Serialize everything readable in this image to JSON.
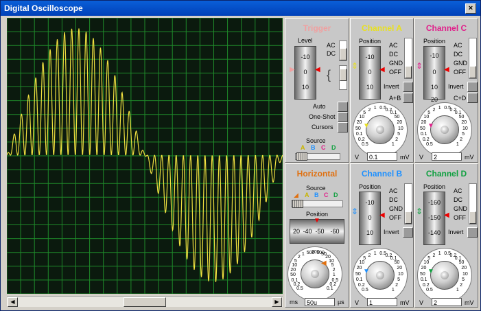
{
  "window": {
    "title": "Digital Oscilloscope",
    "close": "×"
  },
  "colors": {
    "trace": "#f0e040",
    "grid": "#1f8a2a",
    "screen": "#0b1a0e",
    "trigger": "#f0a0a0",
    "channel_a": "#e8e020",
    "channel_b": "#1e90ff",
    "channel_c": "#e0208a",
    "channel_d": "#10a040",
    "horizontal": "#e07010"
  },
  "trigger": {
    "title": "Trigger",
    "level_label": "Level",
    "level_ticks": [
      "-10",
      "0",
      "10"
    ],
    "ac": "AC",
    "dc": "DC",
    "auto": "Auto",
    "one_shot": "One-Shot",
    "cursors": "Cursors",
    "source_label": "Source",
    "sources": [
      "A",
      "B",
      "C",
      "D"
    ]
  },
  "horizontal": {
    "title": "Horizontal",
    "source_label": "Source",
    "sources": [
      "A",
      "B",
      "C",
      "D"
    ],
    "position_label": "Position",
    "position_ticks": [
      "20",
      "-40",
      "-50",
      "-60"
    ],
    "dial_ticks": [
      "0.5",
      "0.2",
      "0.1",
      "50",
      "20",
      "10",
      "5",
      "2",
      "1",
      "500",
      "200",
      "100",
      "50",
      "20",
      "10",
      "5",
      "2",
      "1",
      "0.5",
      "0.2",
      "0.1"
    ],
    "unit_left": "ms",
    "value": "50u",
    "unit_right": "µs"
  },
  "channel_a": {
    "title": "Channel A",
    "position_label": "Position",
    "position_ticks": [
      "-10",
      "0",
      "10"
    ],
    "modes": [
      "AC",
      "DC",
      "GND",
      "OFF"
    ],
    "invert": "Invert",
    "combine": "A+B",
    "dial_ticks": [
      "0.5",
      "0.2",
      "0.1",
      "50",
      "20",
      "10",
      "5",
      "2",
      "1",
      "0.5",
      "0.2",
      "0.1",
      "50",
      "20",
      "10",
      "5",
      "2",
      "1"
    ],
    "unit_left": "V",
    "value": "0.1",
    "unit_right": "mV"
  },
  "channel_b": {
    "title": "Channel B",
    "position_label": "Position",
    "position_ticks": [
      "-10",
      "0",
      "10"
    ],
    "modes": [
      "AC",
      "DC",
      "GND",
      "OFF"
    ],
    "invert": "Invert",
    "dial_ticks": [
      "0.5",
      "0.2",
      "0.1",
      "50",
      "20",
      "10",
      "5",
      "2",
      "1",
      "0.5",
      "0.2",
      "0.1",
      "50",
      "20",
      "10",
      "5",
      "2",
      "1"
    ],
    "unit_left": "V",
    "value": "1",
    "unit_right": "mV"
  },
  "channel_c": {
    "title": "Channel C",
    "position_label": "Position",
    "position_ticks": [
      "-10",
      "0",
      "10",
      "20"
    ],
    "modes": [
      "AC",
      "DC",
      "GND",
      "OFF"
    ],
    "invert": "Invert",
    "combine": "C+D",
    "dial_ticks": [
      "0.5",
      "0.2",
      "0.1",
      "50",
      "20",
      "10",
      "5",
      "2",
      "1",
      "0.5",
      "0.2",
      "0.1",
      "50",
      "20",
      "10",
      "5",
      "2",
      "1"
    ],
    "unit_left": "V",
    "value": "2",
    "unit_right": "mV"
  },
  "channel_d": {
    "title": "Channel D",
    "position_label": "Position",
    "position_ticks": [
      "-160",
      "-150",
      "-140"
    ],
    "modes": [
      "AC",
      "DC",
      "GND",
      "OFF"
    ],
    "invert": "Invert",
    "dial_ticks": [
      "0.5",
      "0.2",
      "0.1",
      "50",
      "20",
      "10",
      "5",
      "2",
      "1",
      "0.5",
      "0.2",
      "0.1",
      "50",
      "20",
      "10",
      "5",
      "2",
      "1"
    ],
    "unit_left": "V",
    "value": "2",
    "unit_right": "mV"
  }
}
